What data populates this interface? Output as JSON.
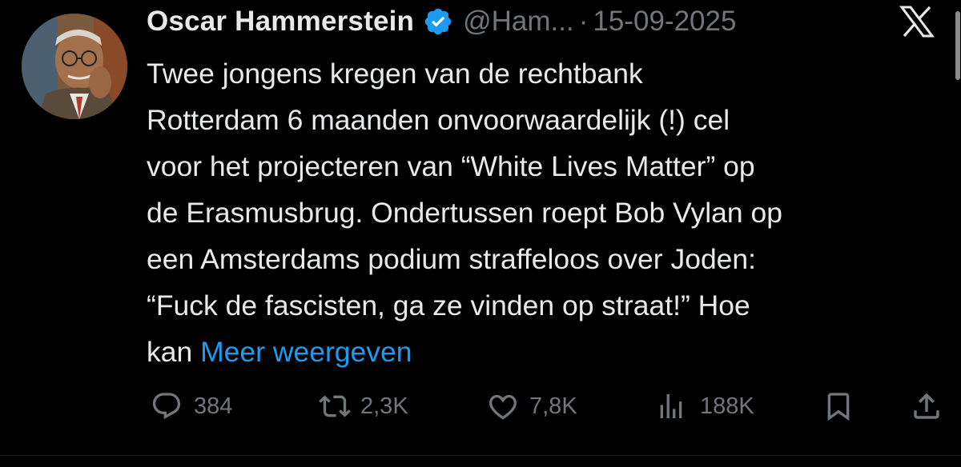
{
  "colors": {
    "background": "#000000",
    "text": "#e7e9ea",
    "muted": "#71767b",
    "link": "#1d9bf0",
    "verified": "#1d9bf0"
  },
  "author": {
    "name": "Oscar Hammerstein",
    "handle": "@Ham...",
    "date": "15-09-2025",
    "verified_icon": "verified-badge-icon",
    "avatar_icon": "profile-photo"
  },
  "platform_icon": "x-logo-icon",
  "tweet": {
    "lines": [
      "Twee jongens kregen van de rechtbank",
      "Rotterdam 6 maanden onvoorwaardelijk (!) cel",
      "voor het projecteren van “White Lives Matter” op",
      "de Erasmusbrug. Ondertussen roept Bob Vylan op",
      "een Amsterdams podium straffeloos over Joden:",
      "“Fuck de fascisten, ga ze vinden op straat!” Hoe"
    ],
    "last_line_prefix": "kan ",
    "show_more": "Meer weergeven"
  },
  "actions": {
    "replies": {
      "icon": "reply-icon",
      "count": "384"
    },
    "reposts": {
      "icon": "repost-icon",
      "count": "2,3K"
    },
    "likes": {
      "icon": "heart-icon",
      "count": "7,8K"
    },
    "views": {
      "icon": "views-chart-icon",
      "count": "188K"
    },
    "bookmark": {
      "icon": "bookmark-icon"
    },
    "share": {
      "icon": "share-icon"
    }
  }
}
